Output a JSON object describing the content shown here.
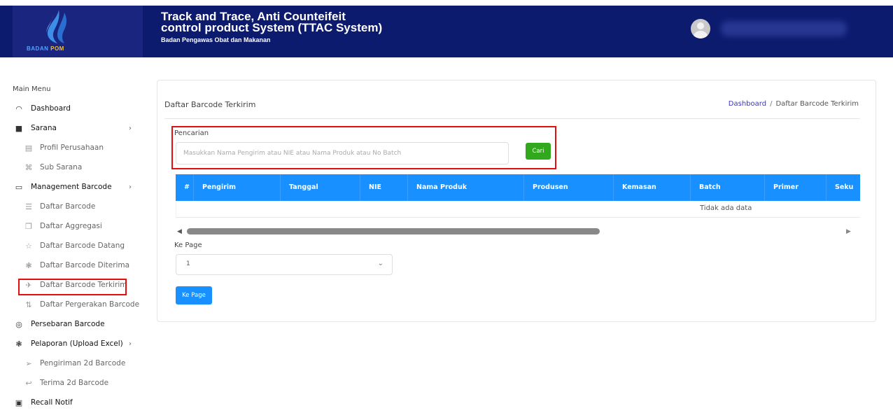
{
  "header": {
    "logo_text_part1": "BADAN",
    "logo_text_part2": "POM",
    "title_line1": "Track and Trace, Anti Counteifeit",
    "title_line2": "control product System (TTAC System)",
    "subtitle": "Badan Pengawas Obat dan Makanan"
  },
  "sidebar": {
    "menu_title": "Main Menu",
    "items": [
      {
        "label": "Dashboard",
        "icon": "dashboard-icon",
        "glyph": "◠",
        "level": "top"
      },
      {
        "label": "Sarana",
        "icon": "folder-user-icon",
        "glyph": "■",
        "level": "top",
        "chevron": "›"
      },
      {
        "label": "Profil Perusahaan",
        "icon": "building-icon",
        "glyph": "▤",
        "level": "sub"
      },
      {
        "label": "Sub Sarana",
        "icon": "hierarchy-icon",
        "glyph": "⌘",
        "level": "sub"
      },
      {
        "label": "Management Barcode",
        "icon": "folder-icon",
        "glyph": "▭",
        "level": "top",
        "chevron": "›"
      },
      {
        "label": "Daftar Barcode",
        "icon": "list-icon",
        "glyph": "☰",
        "level": "sub"
      },
      {
        "label": "Daftar Aggregasi",
        "icon": "copy-icon",
        "glyph": "❐",
        "level": "sub"
      },
      {
        "label": "Daftar Barcode Datang",
        "icon": "star-icon",
        "glyph": "☆",
        "level": "sub"
      },
      {
        "label": "Daftar Barcode Diterima",
        "icon": "gift-icon",
        "glyph": "❃",
        "level": "sub"
      },
      {
        "label": "Daftar Barcode Terkirim",
        "icon": "send-icon",
        "glyph": "✈",
        "level": "sub"
      },
      {
        "label": "Daftar Pergerakan Barcode",
        "icon": "sort-icon",
        "glyph": "⇅",
        "level": "sub"
      },
      {
        "label": "Persebaran Barcode",
        "icon": "location-icon",
        "glyph": "◎",
        "level": "top"
      },
      {
        "label": "Pelaporan (Upload Excel)",
        "icon": "gift-icon",
        "glyph": "❃",
        "level": "top",
        "chevron": "›"
      },
      {
        "label": "Pengiriman 2d Barcode",
        "icon": "send-icon",
        "glyph": "➢",
        "level": "sub"
      },
      {
        "label": "Terima 2d Barcode",
        "icon": "receive-icon",
        "glyph": "↩",
        "level": "sub"
      },
      {
        "label": "Recall Notif",
        "icon": "monitor-icon",
        "glyph": "▣",
        "level": "top"
      }
    ]
  },
  "card": {
    "title": "Daftar Barcode Terkirim",
    "breadcrumb_link": "Dashboard",
    "breadcrumb_sep": "/",
    "breadcrumb_current": "Daftar Barcode Terkirim"
  },
  "search": {
    "label": "Pencarian",
    "placeholder": "Masukkan Nama Pengirim atau NIE atau Nama Produk atau No Batch",
    "button_label": "Cari"
  },
  "table": {
    "columns": [
      "#",
      "Pengirim",
      "Tanggal",
      "NIE",
      "Nama Produk",
      "Produsen",
      "Kemasan",
      "Batch",
      "Primer",
      "Seku"
    ],
    "empty_text": "Tidak ada data"
  },
  "pagination": {
    "label": "Ke Page",
    "selected_value": "1",
    "button_label": "Ke Page"
  }
}
